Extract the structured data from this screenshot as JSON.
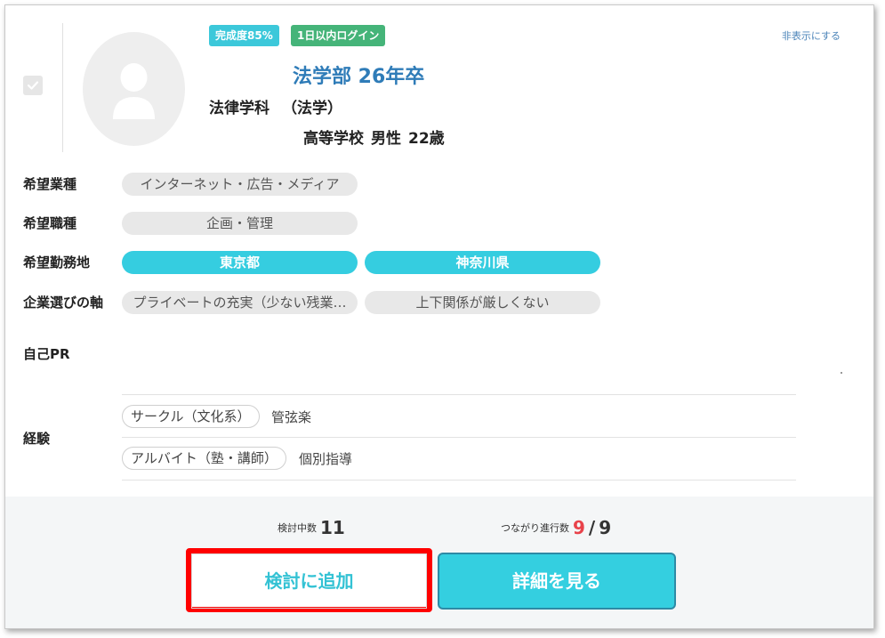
{
  "badges": {
    "completion": "完成度85%",
    "login": "1日以内ログイン"
  },
  "hide_link": "非表示にする",
  "profile": {
    "school": "法学部 26年卒",
    "department": "法律学科",
    "major": "（法学）",
    "school_type": "高等学校",
    "gender": "男性",
    "age": "22歳"
  },
  "rows": {
    "industry": {
      "label": "希望業種",
      "tags": [
        "インターネット・広告・メディア"
      ]
    },
    "job": {
      "label": "希望職種",
      "tags": [
        "企画・管理"
      ]
    },
    "location": {
      "label": "希望勤務地",
      "tags": [
        "東京都",
        "神奈川県"
      ]
    },
    "axis": {
      "label": "企業選びの軸",
      "tags": [
        "プライベートの充実（少ない残業…",
        "上下関係が厳しくない"
      ]
    },
    "pr": {
      "label": "自己PR"
    },
    "experience": {
      "label": "経験",
      "items": [
        {
          "category": "サークル（文化系）",
          "value": "管弦楽"
        },
        {
          "category": "アルバイト（塾・講師）",
          "value": "個別指導"
        }
      ]
    }
  },
  "stats": {
    "considering_label": "検討中数",
    "considering_count": "11",
    "connections_label": "つながり進行数",
    "connections_current": "9",
    "separator": "/",
    "connections_total": "9"
  },
  "buttons": {
    "consider": "検討に追加",
    "detail": "詳細を見る"
  },
  "colors": {
    "accent": "#35cde0",
    "login_badge": "#45b479",
    "highlight_border": "#ff0000",
    "count_red": "#e8424a",
    "title_blue": "#2f7cb8"
  },
  "icons": {
    "checkbox": "check-icon",
    "avatar": "user-silhouette-icon"
  }
}
